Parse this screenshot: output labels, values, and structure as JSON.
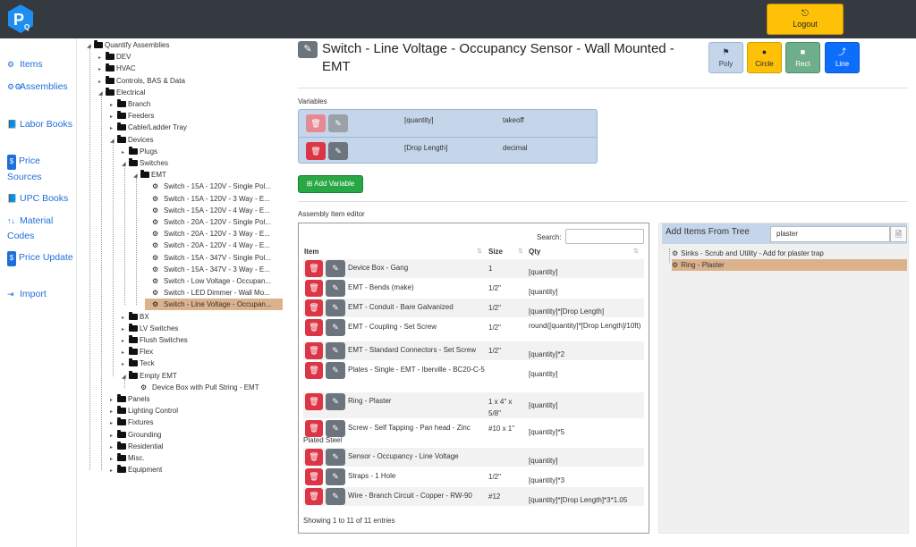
{
  "app": {
    "logo_text": "PQ",
    "logout_label": "Logout"
  },
  "sidebar": {
    "items": [
      {
        "icon": "gear-icon",
        "label": "Items"
      },
      {
        "icon": "gears-icon",
        "label": "Assemblies"
      },
      {
        "icon": "book-icon",
        "label": "Labor Books"
      },
      {
        "icon": "dollar-icon",
        "label": "Price Sources"
      },
      {
        "icon": "book-icon",
        "label": "UPC Books"
      },
      {
        "icon": "sort-icon",
        "label": "Material Codes"
      },
      {
        "icon": "dollar-icon",
        "label": "Price Update"
      },
      {
        "icon": "import-icon",
        "label": "Import"
      }
    ]
  },
  "tree": {
    "nodes": [
      {
        "label": "Quantify Assemblies",
        "kind": "folder"
      },
      {
        "label": "DEV",
        "kind": "folder"
      },
      {
        "label": "HVAC",
        "kind": "folder"
      },
      {
        "label": "Controls, BAS & Data",
        "kind": "folder"
      },
      {
        "label": "Electrical",
        "kind": "folder"
      },
      {
        "label": "Branch",
        "kind": "folder"
      },
      {
        "label": "Feeders",
        "kind": "folder"
      },
      {
        "label": "Cable/Ladder Tray",
        "kind": "folder"
      },
      {
        "label": "Devices",
        "kind": "folder"
      },
      {
        "label": "Plugs",
        "kind": "folder"
      },
      {
        "label": "Switches",
        "kind": "folder"
      },
      {
        "label": "EMT",
        "kind": "folder"
      },
      {
        "label": "Switch - 15A - 120V - Single Pol...",
        "kind": "assembly"
      },
      {
        "label": "Switch - 15A - 120V - 3 Way - E...",
        "kind": "assembly"
      },
      {
        "label": "Switch - 15A - 120V - 4 Way - E...",
        "kind": "assembly"
      },
      {
        "label": "Switch - 20A - 120V - Single Pol...",
        "kind": "assembly"
      },
      {
        "label": "Switch - 20A - 120V - 3 Way - E...",
        "kind": "assembly"
      },
      {
        "label": "Switch - 20A - 120V - 4 Way - E...",
        "kind": "assembly"
      },
      {
        "label": "Switch - 15A - 347V - Single Pol...",
        "kind": "assembly"
      },
      {
        "label": "Switch - 15A - 347V - 3 Way - E...",
        "kind": "assembly"
      },
      {
        "label": "Switch - Low Voltage - Occupan...",
        "kind": "assembly"
      },
      {
        "label": "Switch - LED Dimmer - Wall Mo...",
        "kind": "assembly"
      },
      {
        "label": "Switch - Line Voltage - Occupan...",
        "kind": "assembly"
      },
      {
        "label": "BX",
        "kind": "folder"
      },
      {
        "label": "LV Switches",
        "kind": "folder"
      },
      {
        "label": "Flush Switches",
        "kind": "folder"
      },
      {
        "label": "Flex",
        "kind": "folder"
      },
      {
        "label": "Teck",
        "kind": "folder"
      },
      {
        "label": "Empty EMT",
        "kind": "folder"
      },
      {
        "label": "Device Box with Pull String - EMT",
        "kind": "assembly"
      },
      {
        "label": "Panels",
        "kind": "folder"
      },
      {
        "label": "Lighting Control",
        "kind": "folder"
      },
      {
        "label": "Fixtures",
        "kind": "folder"
      },
      {
        "label": "Grounding",
        "kind": "folder"
      },
      {
        "label": "Residential",
        "kind": "folder"
      },
      {
        "label": "Misc.",
        "kind": "folder"
      },
      {
        "label": "Equipment",
        "kind": "folder"
      }
    ]
  },
  "assembly": {
    "title": "Switch - Line Voltage - Occupancy Sensor - Wall Mounted - EMT"
  },
  "tools": [
    {
      "label": "Poly",
      "icon": "poly-icon"
    },
    {
      "label": "Circle",
      "icon": "circle-icon"
    },
    {
      "label": "Rect",
      "icon": "rect-icon"
    },
    {
      "label": "Line",
      "icon": "line-icon"
    }
  ],
  "variables": {
    "heading": "Variables",
    "rows": [
      {
        "name": "[quantity]",
        "type": "takeoff"
      },
      {
        "name": "[Drop Length]",
        "type": "decimal"
      }
    ],
    "add_label": "Add Variable"
  },
  "editor": {
    "heading": "Assembly Item editor",
    "search_label": "Search:",
    "columns": {
      "item": "Item",
      "size": "Size",
      "qty": "Qty"
    },
    "rows": [
      {
        "item": "Device Box - Gang",
        "size": "1",
        "qty": "[quantity]"
      },
      {
        "item": "EMT - Bends (make)",
        "size": "1/2\"",
        "qty": "[quantity]"
      },
      {
        "item": "EMT - Conduit - Bare Galvanized",
        "size": "1/2\"",
        "qty": "[quantity]*[Drop Length]"
      },
      {
        "item": "EMT - Coupling - Set Screw",
        "size": "1/2\"",
        "qty": "round([quantity]*[Drop Length]/10ft)"
      },
      {
        "item": "EMT - Standard Connectors - Set Screw",
        "size": "1/2\"",
        "qty": "[quantity]*2"
      },
      {
        "item": "Plates - Single - EMT - Iberville - BC20-C-5",
        "size": "",
        "qty": "[quantity]"
      },
      {
        "item": "Ring - Plaster",
        "size": "1 x 4\" x 5/8\"",
        "qty": "[quantity]"
      },
      {
        "item": "Screw - Self Tapping - Pan head - Zinc Plated Steel",
        "size": "#10 x 1\"",
        "qty": "[quantity]*5"
      },
      {
        "item": "Sensor - Occupancy - Line Voltage",
        "size": "",
        "qty": "[quantity]"
      },
      {
        "item": "Straps - 1 Hole",
        "size": "1/2\"",
        "qty": "[quantity]*3"
      },
      {
        "item": "Wire - Branch Circuit - Copper - RW-90",
        "size": "#12",
        "qty": "[quantity]*[Drop Length]*3*1.05"
      }
    ],
    "showing": "Showing 1 to 11 of 11 entries"
  },
  "tree_add": {
    "title": "Add Items From Tree",
    "search_value": "plaster",
    "results": [
      {
        "label": "Sinks - Scrub and Utility - Add for plaster trap"
      },
      {
        "label": "Ring - Plaster"
      }
    ]
  }
}
